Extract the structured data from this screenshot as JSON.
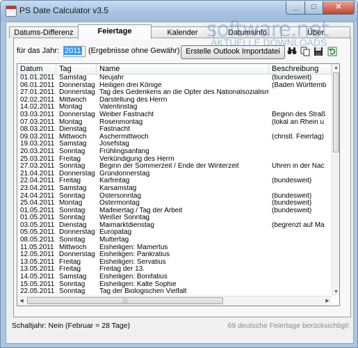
{
  "window": {
    "title": "PS Date Calculator v3.5"
  },
  "watermark": {
    "main": "software.net",
    "sub": "AKTUELLE DOWNLOADS"
  },
  "tabs": [
    {
      "label": "Datums-Differenz"
    },
    {
      "label": "Feiertage",
      "active": true
    },
    {
      "label": "Kalender"
    },
    {
      "label": "Datumsinfo"
    },
    {
      "label": "Über"
    }
  ],
  "controls": {
    "year_label": "für das Jahr:",
    "year_value": "2011",
    "hint": "(Ergebnisse ohne Gewähr)",
    "export_button": "Erstelle Outlook Importdatei"
  },
  "toolbar": {
    "icons": [
      "binoculars-icon",
      "copy-icon",
      "save-icon",
      "refresh-icon"
    ]
  },
  "table": {
    "columns": [
      "Datum",
      "Tag",
      "Name",
      "Beschreibung"
    ],
    "rows": [
      [
        "01.01.2011",
        "Samstag",
        "Neujahr",
        "(bundesweit)"
      ],
      [
        "06.01.2011",
        "Donnerstag",
        "Heiligen drei Könige",
        "(Baden Württemb"
      ],
      [
        "27.01.2011",
        "Donnerstag",
        "Tag des Gedenkens an die Opfer des Nationalsozialismus",
        ""
      ],
      [
        "02.02.2011",
        "Mittwoch",
        "Darstellung des Herrn",
        ""
      ],
      [
        "14.02.2011",
        "Montag",
        "Valentinstag",
        ""
      ],
      [
        "03.03.2011",
        "Donnerstag",
        "Weiber Fastnacht",
        "Beginn des Straß"
      ],
      [
        "07.03.2011",
        "Montag",
        "Rosenmontag",
        "(lokal an Rhein u"
      ],
      [
        "08.03.2011",
        "Dienstag",
        "Fastnacht",
        ""
      ],
      [
        "09.03.2011",
        "Mittwoch",
        "Aschermittwoch",
        "(christl. Feiertag)"
      ],
      [
        "19.03.2011",
        "Samstag",
        "Josefstag",
        ""
      ],
      [
        "20.03.2011",
        "Sonntag",
        "Frühlingsanfang",
        ""
      ],
      [
        "25.03.2011",
        "Freitag",
        "Verkündigung des Herrn",
        ""
      ],
      [
        "27.03.2011",
        "Sonntag",
        "Beginn der Sommerzeit / Ende der Winterzeit",
        "Uhren in der Nac"
      ],
      [
        "21.04.2011",
        "Donnerstag",
        "Gründonnerstag",
        ""
      ],
      [
        "22.04.2011",
        "Freitag",
        "Karfreitag",
        "(bundesweit)"
      ],
      [
        "23.04.2011",
        "Samstag",
        "Karsamstag",
        ""
      ],
      [
        "24.04.2011",
        "Sonntag",
        "Ostersonntag",
        "(bundesweit)"
      ],
      [
        "25.04.2011",
        "Montag",
        "Ostermontag",
        "(bundesweit)"
      ],
      [
        "01.05.2011",
        "Sonntag",
        "Maifeiertag / Tag der Arbeit",
        "(bundesweit)"
      ],
      [
        "01.05.2011",
        "Sonntag",
        "Weißer Sonntag",
        ""
      ],
      [
        "03.05.2011",
        "Dienstag",
        "Maimarktdienstag",
        "(begrenzt auf Ma"
      ],
      [
        "05.05.2011",
        "Donnerstag",
        "Europatag",
        ""
      ],
      [
        "08.05.2011",
        "Sonntag",
        "Muttertag",
        ""
      ],
      [
        "11.05.2011",
        "Mittwoch",
        "Eisheiligen: Mamertus",
        ""
      ],
      [
        "12.05.2011",
        "Donnerstag",
        "Eisheiligen: Pankratius",
        ""
      ],
      [
        "13.05.2011",
        "Freitag",
        "Eisheiligen: Servatius",
        ""
      ],
      [
        "13.05.2011",
        "Freitag",
        "Freitag der 13.",
        ""
      ],
      [
        "14.05.2011",
        "Samstag",
        "Eisheiligen: Bonifatius",
        ""
      ],
      [
        "15.05.2011",
        "Sonntag",
        "Eisheiligen: Kalte Sophie",
        ""
      ],
      [
        "22.05.2011",
        "Sonntag",
        "Tag der Biologischen Vielfalt",
        ""
      ]
    ]
  },
  "status": {
    "leap_year": "Schaltjahr: Nein (Februar = 28 Tage)",
    "count": "69 deutsche Feiertage berücksichtigt!"
  }
}
